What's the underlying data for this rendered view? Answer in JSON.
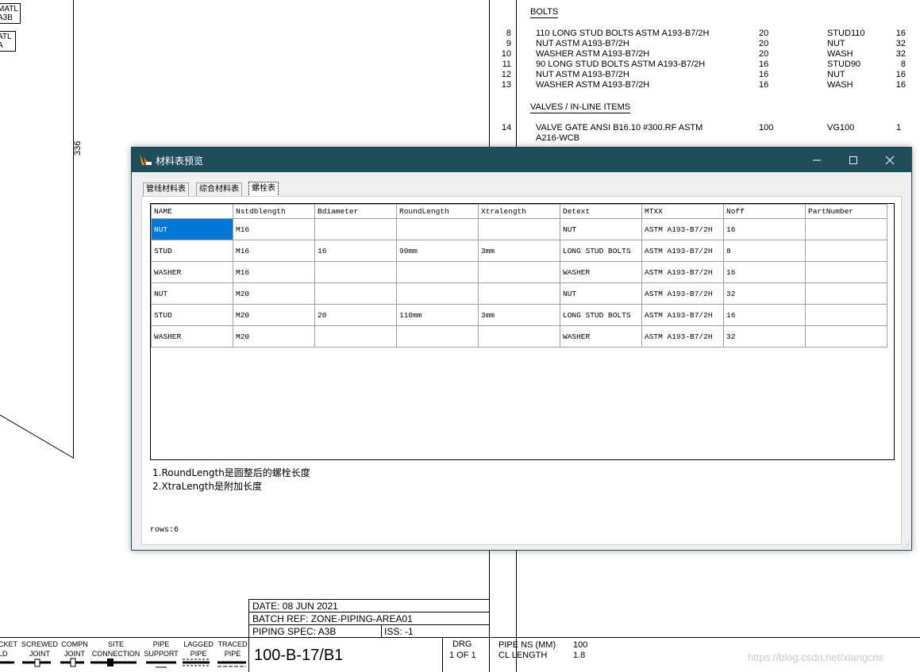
{
  "drawing": {
    "top_left_labels": [
      {
        "line1": "MATL",
        "line2": "A3B"
      },
      {
        "line1": "ATL",
        "line2": "A"
      }
    ],
    "dimension_text": "336",
    "bolts_heading": "BOLTS",
    "bolts": [
      {
        "num": "8",
        "desc": "110 LONG STUD BOLTS ASTM A193-B7/2H",
        "size": "20",
        "code": "STUD110",
        "qty": "16"
      },
      {
        "num": "9",
        "desc": "NUT ASTM A193-B7/2H",
        "size": "20",
        "code": "NUT",
        "qty": "32"
      },
      {
        "num": "10",
        "desc": "WASHER ASTM A193-B7/2H",
        "size": "20",
        "code": "WASH",
        "qty": "32"
      },
      {
        "num": "11",
        "desc": "90 LONG STUD BOLTS ASTM A193-B7/2H",
        "size": "16",
        "code": "STUD90",
        "qty": "8"
      },
      {
        "num": "12",
        "desc": "NUT ASTM A193-B7/2H",
        "size": "16",
        "code": "NUT",
        "qty": "16"
      },
      {
        "num": "13",
        "desc": "WASHER ASTM A193-B7/2H",
        "size": "16",
        "code": "WASH",
        "qty": "16"
      }
    ],
    "valves_heading": "VALVES / IN-LINE ITEMS",
    "valve": {
      "num": "14",
      "desc1": "VALVE GATE ANSI B16.10 #300.RF ASTM",
      "desc2": "A216-WCB",
      "size": "100",
      "code": "VG100",
      "qty": "1"
    },
    "title_block": {
      "date": "DATE: 08 JUN 2021",
      "batch_ref": "BATCH REF: ZONE-PIPING-AREA01",
      "piping_spec": "PIPING SPEC: A3B",
      "iss": "ISS: -1",
      "drawing_number": "100-B-17/B1",
      "drg_label": "DRG",
      "drg_value": "1 OF 1",
      "pipe_ns_label": "PIPE NS   (MM)",
      "pipe_ns_value": "100",
      "cl_length_label": "CL LENGTH",
      "cl_length_value": "1.8"
    },
    "legend": [
      {
        "line1": "CKET",
        "line2": "LD"
      },
      {
        "line1": "SCREWED",
        "line2": "JOINT"
      },
      {
        "line1": "COMPN",
        "line2": "JOINT"
      },
      {
        "line1": "SITE",
        "line2": "CONNECTION"
      },
      {
        "line1": "PIPE",
        "line2": "SUPPORT"
      },
      {
        "line1": "LAGGED",
        "line2": "PIPE"
      },
      {
        "line1": "TRACED",
        "line2": "PIPE"
      }
    ],
    "watermark": "https://blog.csdn.net/xiangcns"
  },
  "dialog": {
    "title": "材料表预览",
    "tabs": [
      {
        "label": "管线材料表",
        "active": false
      },
      {
        "label": "综合材料表",
        "active": false
      },
      {
        "label": "螺栓表",
        "active": true
      }
    ],
    "columns": [
      "NAME",
      "Nstdblength",
      "Bdiameter",
      "RoundLength",
      "Xtralength",
      "Detext",
      "MTXX",
      "Noff",
      "PartNumber"
    ],
    "rows": [
      [
        "NUT",
        "M16",
        "",
        "",
        "",
        "NUT",
        "ASTM A193-B7/2H",
        "16",
        ""
      ],
      [
        "STUD",
        "M16",
        "16",
        "90mm",
        "3mm",
        "LONG STUD BOLTS",
        "ASTM A193-B7/2H",
        "8",
        ""
      ],
      [
        "WASHER",
        "M16",
        "",
        "",
        "",
        "WASHER",
        "ASTM A193-B7/2H",
        "16",
        ""
      ],
      [
        "NUT",
        "M20",
        "",
        "",
        "",
        "NUT",
        "ASTM A193-B7/2H",
        "32",
        ""
      ],
      [
        "STUD",
        "M20",
        "20",
        "110mm",
        "3mm",
        "LONG STUD BOLTS",
        "ASTM A193-B7/2H",
        "16",
        ""
      ],
      [
        "WASHER",
        "M20",
        "",
        "",
        "",
        "WASHER",
        "ASTM A193-B7/2H",
        "32",
        ""
      ]
    ],
    "notes": [
      "1.RoundLength是圆整后的螺栓长度",
      "2.XtraLength是附加长度"
    ],
    "row_count": "rows:6",
    "colors": {
      "titlebar": "#1f4e5a",
      "selection": "#0078d7"
    }
  }
}
